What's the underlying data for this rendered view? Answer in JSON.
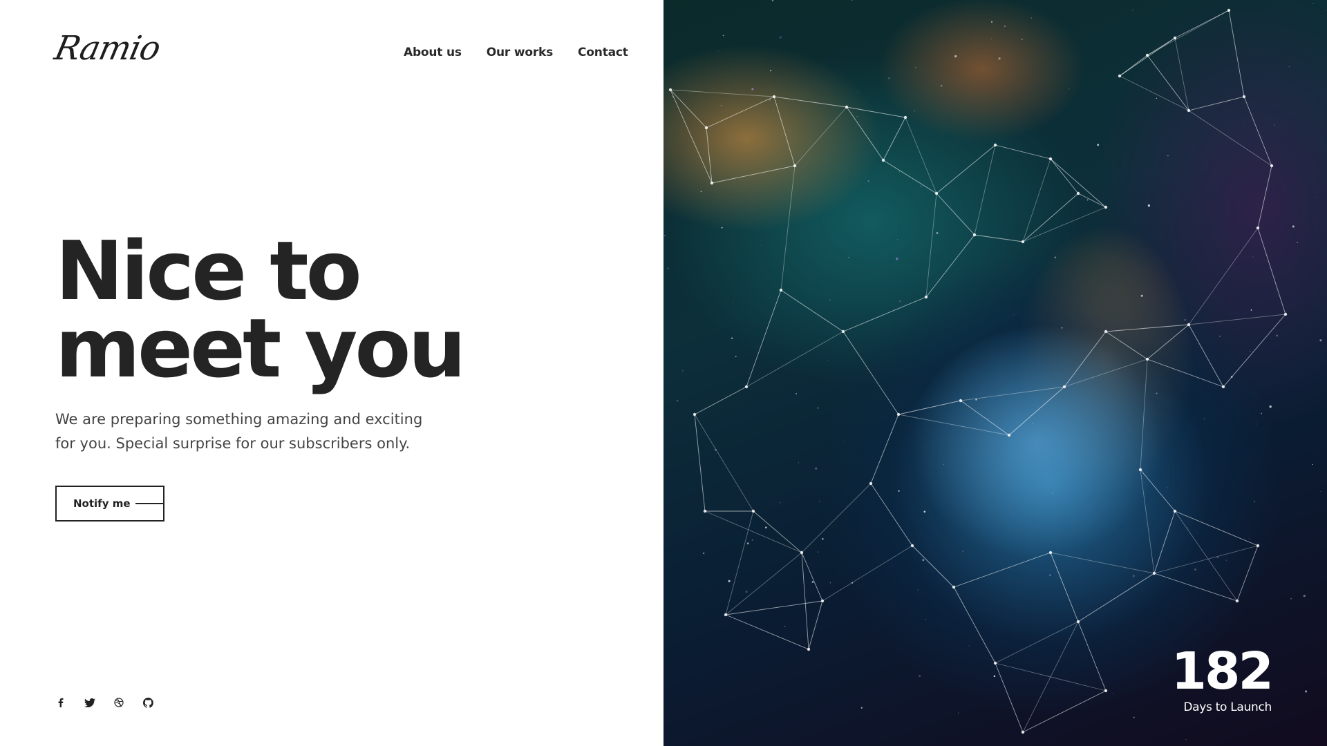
{
  "logo": {
    "text": "Ramio"
  },
  "nav": {
    "items": [
      "About us",
      "Our works",
      "Contact"
    ]
  },
  "hero": {
    "headline_line1": "Nice to",
    "headline_line2": "meet you",
    "description": "We are preparing something amazing and exciting for you. Special surprise for our subscribers only.",
    "cta_label": "Notify me"
  },
  "social": {
    "icons": [
      "facebook-icon",
      "twitter-icon",
      "dribbble-icon",
      "github-icon"
    ]
  },
  "countdown": {
    "value": "182",
    "label": "Days to Launch"
  },
  "colors": {
    "text": "#222222",
    "background": "#ffffff",
    "accent_text": "#ffffff"
  }
}
